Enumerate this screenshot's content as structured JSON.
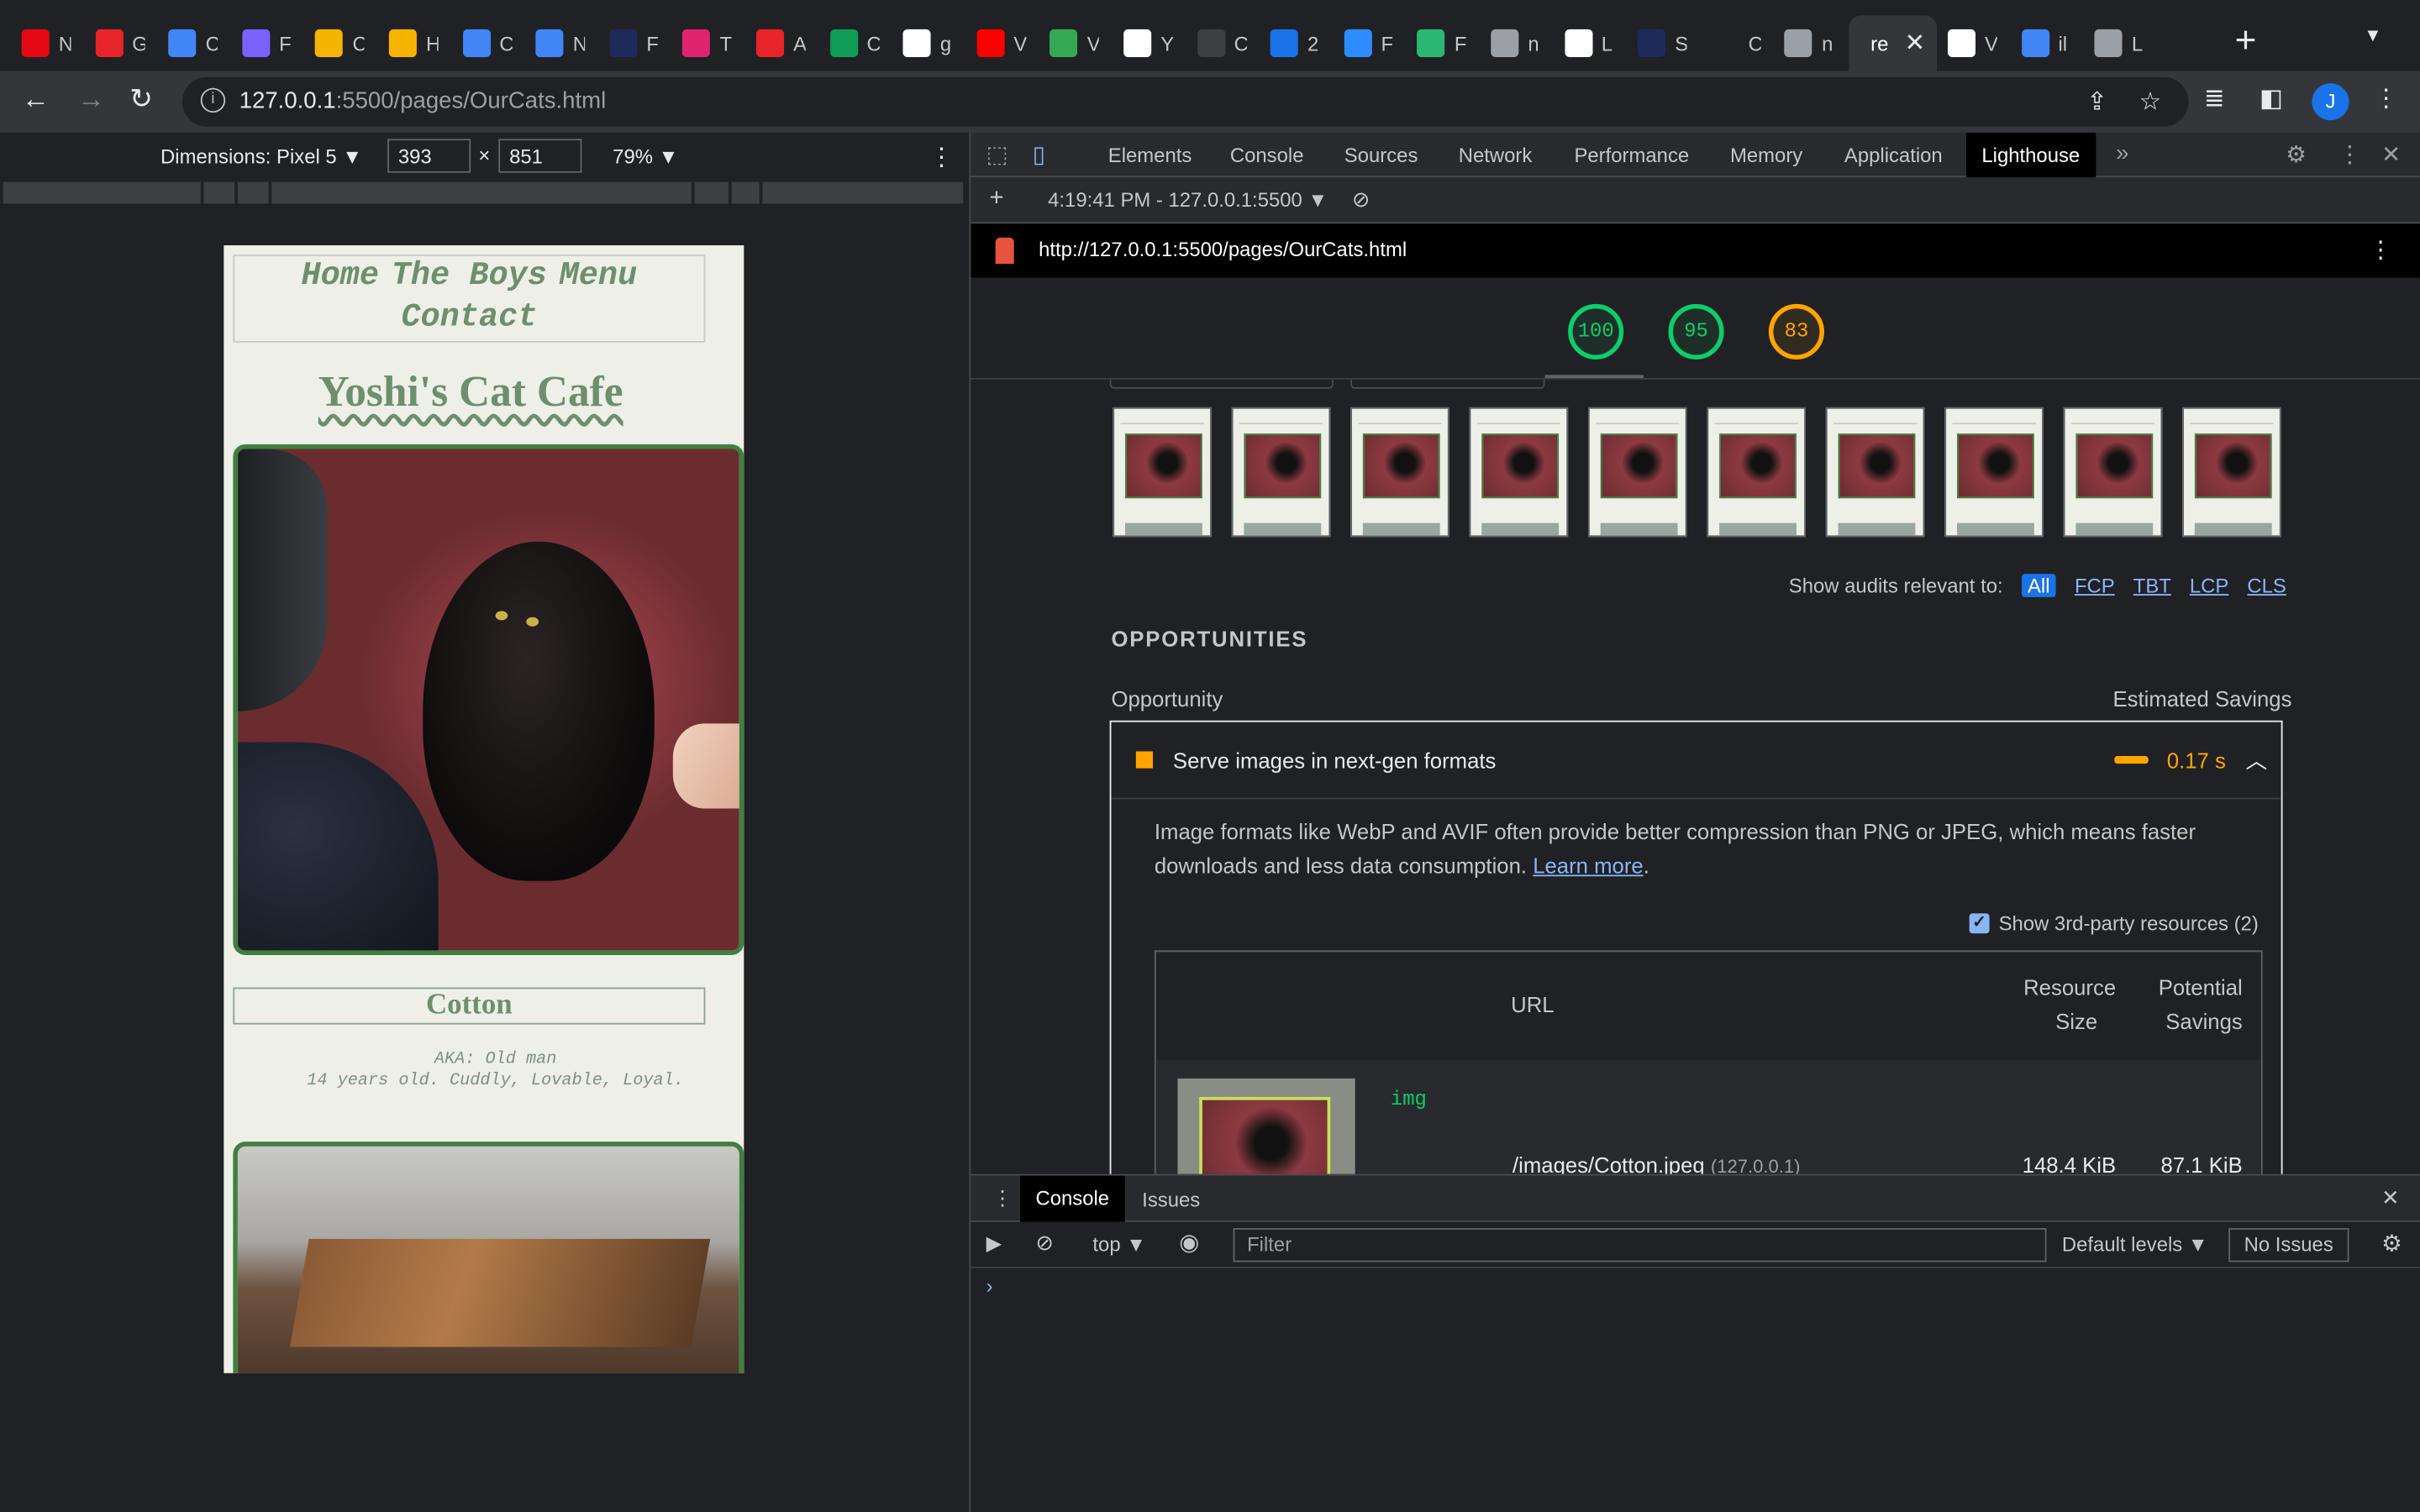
{
  "browser": {
    "tabs": [
      {
        "label": "N",
        "icon": "netflix-icon",
        "color": "#e50914"
      },
      {
        "label": "G",
        "icon": "canvas-icon",
        "color": "#e72429"
      },
      {
        "label": "C",
        "icon": "docs-icon",
        "color": "#4285f4"
      },
      {
        "label": "F",
        "icon": "app-icon",
        "color": "#7b61ff"
      },
      {
        "label": "C",
        "icon": "page-icon",
        "color": "#f4b400"
      },
      {
        "label": "H",
        "icon": "page-icon",
        "color": "#f4b400"
      },
      {
        "label": "C",
        "icon": "docs-icon",
        "color": "#4285f4"
      },
      {
        "label": "N",
        "icon": "docs-icon",
        "color": "#4285f4"
      },
      {
        "label": "F",
        "icon": "codesignal-icon",
        "color": "#1e2b5a"
      },
      {
        "label": "T",
        "icon": "rv-icon",
        "color": "#e0246f"
      },
      {
        "label": "A",
        "icon": "canvas-icon",
        "color": "#e72429"
      },
      {
        "label": "C",
        "icon": "sheets-plus-icon",
        "color": "#0f9d58"
      },
      {
        "label": "g",
        "icon": "google-icon",
        "color": "#ffffff"
      },
      {
        "label": "V",
        "icon": "youtube-icon",
        "color": "#ff0000"
      },
      {
        "label": "V",
        "icon": "green-app-icon",
        "color": "#34a853"
      },
      {
        "label": "Y",
        "icon": "github-icon",
        "color": "#ffffff"
      },
      {
        "label": "C",
        "icon": "circle-icon",
        "color": "#3c4043"
      },
      {
        "label": "2",
        "icon": "wave-icon",
        "color": "#1a73e8"
      },
      {
        "label": "F",
        "icon": "zoom-icon",
        "color": "#2d8cff"
      },
      {
        "label": "F",
        "icon": "w-icon",
        "color": "#2bb673"
      },
      {
        "label": "n",
        "icon": "globe-icon",
        "color": "#9aa0a6"
      },
      {
        "label": "L",
        "icon": "github-icon",
        "color": "#ffffff"
      },
      {
        "label": "S",
        "icon": "codesignal-icon",
        "color": "#1e2b5a"
      },
      {
        "label": "C",
        "icon": "m-icon",
        "color": "#202124"
      },
      {
        "label": "n",
        "icon": "globe-icon",
        "color": "#9aa0a6"
      },
      {
        "label": "re",
        "icon": "",
        "color": "#35363a",
        "active": true
      },
      {
        "label": "V",
        "icon": "notion-icon",
        "color": "#ffffff"
      },
      {
        "label": "il",
        "icon": "heart-icon",
        "color": "#4285f4"
      },
      {
        "label": "L",
        "icon": "globe-icon",
        "color": "#9aa0a6"
      }
    ],
    "url_host": "127.0.0.1",
    "url_rest": ":5500/pages/OurCats.html",
    "avatar_letter": "J"
  },
  "device_toolbar": {
    "device": "Dimensions: Pixel 5 ▼",
    "width": "393",
    "height": "851",
    "times": "×",
    "zoom": "79% ▼"
  },
  "site": {
    "nav": [
      "Home",
      "The Boys",
      "Menu",
      "Contact"
    ],
    "title": "Yoshi's Cat Cafe",
    "cat_name": "Cotton",
    "aka": "AKA: Old man",
    "desc": "14 years old. Cuddly, Lovable, Loyal."
  },
  "devtools": {
    "tabs": [
      "Elements",
      "Console",
      "Sources",
      "Network",
      "Performance",
      "Memory",
      "Application",
      "Lighthouse"
    ],
    "active_tab": "Lighthouse",
    "report_select": "4:19:41 PM - 127.0.0.1:5500 ▼",
    "report_url": "http://127.0.0.1:5500/pages/OurCats.html",
    "scores": [
      {
        "value": 100,
        "level": "green"
      },
      {
        "value": 95,
        "level": "green"
      },
      {
        "value": 83,
        "level": "orange"
      }
    ],
    "show_audits_label": "Show audits relevant to:",
    "filters": [
      "All",
      "FCP",
      "TBT",
      "LCP",
      "CLS"
    ],
    "section_title": "OPPORTUNITIES",
    "col_opportunity": "Opportunity",
    "col_savings": "Estimated Savings",
    "audit": {
      "title": "Serve images in next-gen formats",
      "savings": "0.17 s",
      "desc_before": "Image formats like WebP and AVIF often provide better compression than PNG or JPEG, which means faster downloads and less data consumption. ",
      "learn_more": "Learn more",
      "desc_after": ".",
      "third_party": "Show 3rd-party resources (2)",
      "col_url": "URL",
      "col_size_1": "Resource",
      "col_size_2": "Size",
      "col_pot_1": "Potential",
      "col_pot_2": "Savings",
      "row_tag": "img",
      "row_url": "/images/Cotton.jpeg",
      "row_host": "(127.0.0.1)",
      "row_size": "148.4 KiB",
      "row_savings": "87.1 KiB"
    }
  },
  "drawer": {
    "tabs": [
      "Console",
      "Issues"
    ],
    "context": "top ▼",
    "filter_placeholder": "Filter",
    "levels": "Default levels ▼",
    "issues": "No Issues",
    "prompt": "›"
  }
}
